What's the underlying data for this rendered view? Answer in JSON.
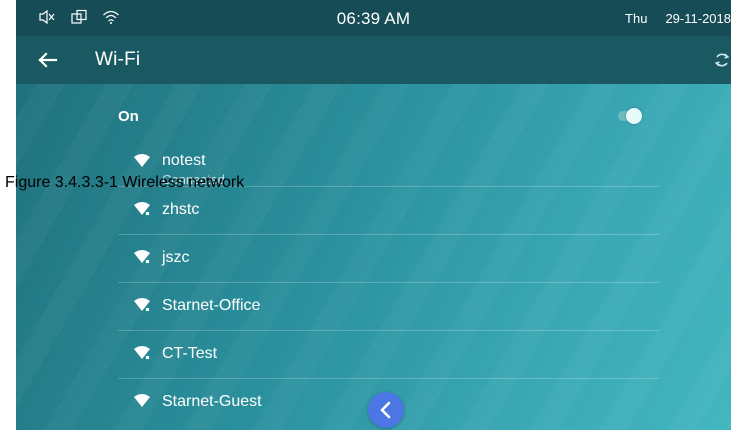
{
  "caption": "Figure 3.4.3.3-1 Wireless network",
  "status_bar": {
    "time": "06:39 AM",
    "day": "Thu",
    "date": "29-11-2018",
    "icons": [
      "volume-muted-icon",
      "screen-rotate-icon",
      "wifi-signal-icon"
    ]
  },
  "toolbar": {
    "title": "Wi-Fi",
    "back_icon": "arrow-left-icon",
    "refresh_icon": "refresh-icon"
  },
  "wifi_toggle": {
    "label": "On",
    "enabled": true
  },
  "networks": [
    {
      "name": "notest",
      "sub": "Connected"
    },
    {
      "name": "zhstc",
      "sub": ""
    },
    {
      "name": "jszc",
      "sub": ""
    },
    {
      "name": "Starnet-Office",
      "sub": ""
    },
    {
      "name": "CT-Test",
      "sub": ""
    },
    {
      "name": "Starnet-Guest",
      "sub": ""
    }
  ],
  "floating_button_icon": "chevron-left-icon",
  "colors": {
    "status_bar": "#154c55",
    "toolbar": "#1a5962",
    "accent_button": "#4b76e3",
    "text": "#ffffff"
  }
}
